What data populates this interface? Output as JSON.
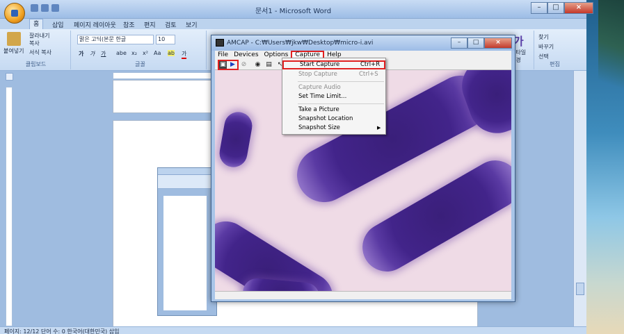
{
  "word": {
    "title": "문서1 - Microsoft Word",
    "tabs": [
      "홈",
      "삽입",
      "페이지 레이아웃",
      "참조",
      "편지",
      "검토",
      "보기"
    ],
    "clipboard": {
      "paste": "붙여넣기",
      "cut": "잘라내기",
      "copy": "복사",
      "format_painter": "서식 복사",
      "label": "클립보드"
    },
    "font": {
      "name": "맑은 고딕(본문 한글",
      "size": "10",
      "label": "글꼴"
    },
    "editing": {
      "find": "찾기",
      "replace": "바꾸기",
      "select": "선택",
      "label": "편집"
    },
    "style_label": "스타일",
    "style_change": "변경",
    "status_text": "페이지: 12/12   단어 수: 0   한국어(대한민국)   삽입"
  },
  "amcap": {
    "title": "AMCAP - C:₩Users₩jkw₩Desktop₩micro-i.avi",
    "menus": [
      "File",
      "Devices",
      "Options",
      "Capture",
      "Help"
    ],
    "open_menu": "Capture",
    "capture_menu": [
      {
        "label": "Start Capture",
        "shortcut": "Ctrl+R",
        "disabled": false,
        "highlighted": true
      },
      {
        "label": "Stop Capture",
        "shortcut": "Ctrl+S",
        "disabled": true
      },
      {
        "label": "Capture Audio",
        "disabled": true
      },
      {
        "label": "Set Time Limit...",
        "disabled": false
      },
      {
        "label": "Take a Picture",
        "disabled": false
      },
      {
        "label": "Snapshot Location",
        "disabled": false
      },
      {
        "label": "Snapshot Size",
        "disabled": false,
        "submenu": true
      }
    ],
    "toolbar_icons": [
      "camera-icon",
      "play-icon",
      "stop-icon",
      "capture-icon",
      "screen-icon",
      "pointer-icon"
    ]
  },
  "colors": {
    "highlight_red": "#e02020",
    "stain_purple": "#42248a",
    "background_pink": "#efdbe6"
  }
}
